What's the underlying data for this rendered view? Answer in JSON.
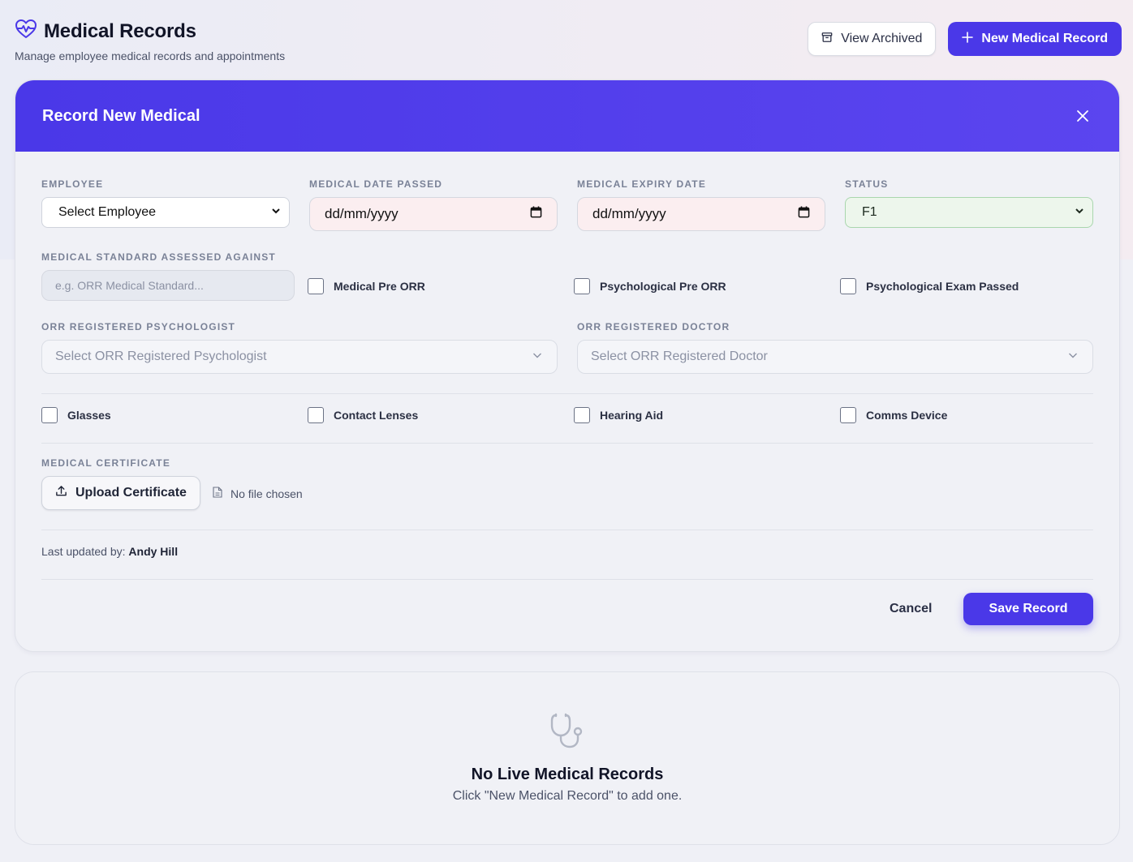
{
  "header": {
    "title": "Medical Records",
    "subtitle": "Manage employee medical records and appointments",
    "view_archived_label": "View Archived",
    "new_record_label": "New Medical Record"
  },
  "form": {
    "title": "Record New Medical",
    "employee": {
      "label": "Employee",
      "value": "Select Employee"
    },
    "date_passed": {
      "label": "Medical Date Passed",
      "value": "dd/mm/yyyy"
    },
    "expiry_date": {
      "label": "Medical Expiry Date",
      "value": "dd/mm/yyyy"
    },
    "status": {
      "label": "Status",
      "value": "F1"
    },
    "standard": {
      "label": "Medical Standard Assessed Against",
      "placeholder": "e.g. ORR Medical Standard..."
    },
    "checks_top": [
      {
        "label": "Medical Pre ORR",
        "checked": false
      },
      {
        "label": "Psychological Pre ORR",
        "checked": false
      },
      {
        "label": "Psychological Exam Passed",
        "checked": false
      }
    ],
    "psychologist": {
      "label": "ORR Registered Psychologist",
      "placeholder": "Select ORR Registered Psychologist"
    },
    "doctor": {
      "label": "ORR Registered Doctor",
      "placeholder": "Select ORR Registered Doctor"
    },
    "checks_aids": [
      {
        "label": "Glasses",
        "checked": false
      },
      {
        "label": "Contact Lenses",
        "checked": false
      },
      {
        "label": "Hearing Aid",
        "checked": false
      },
      {
        "label": "Comms Device",
        "checked": false
      }
    ],
    "certificate": {
      "label": "Medical Certificate",
      "upload_label": "Upload Certificate",
      "file_status": "No file chosen"
    },
    "last_updated_prefix": "Last updated by:",
    "last_updated_by": "Andy Hill",
    "cancel_label": "Cancel",
    "save_label": "Save Record"
  },
  "empty_state": {
    "title": "No Live Medical Records",
    "subtitle": "Click \"New Medical Record\" to add one."
  },
  "colors": {
    "accent": "#4a38e8",
    "status_bg": "#edf6ec"
  },
  "icons": [
    "heart-pulse-icon",
    "archive-icon",
    "plus-icon",
    "close-icon",
    "calendar-icon",
    "chevron-down-icon",
    "upload-icon",
    "file-icon",
    "stethoscope-icon"
  ]
}
